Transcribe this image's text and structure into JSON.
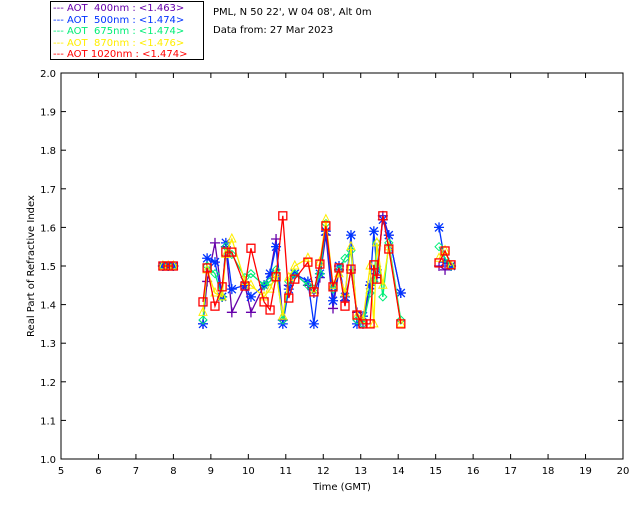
{
  "header": {
    "location": "PML, N 50 22', W 04 08', Alt 0m",
    "date": "Data from: 27 Mar 2023"
  },
  "chart_data": {
    "type": "line",
    "xlabel": "Time (GMT)",
    "ylabel": "Real Part of Refractive Index",
    "xlim": [
      5,
      20
    ],
    "ylim": [
      1.0,
      2.0
    ],
    "xticks": [
      "5",
      "6",
      "7",
      "8",
      "9",
      "10",
      "11",
      "12",
      "13",
      "14",
      "15",
      "16",
      "17",
      "18",
      "19",
      "20"
    ],
    "yticks": [
      "1.0",
      "1.1",
      "1.2",
      "1.3",
      "1.4",
      "1.5",
      "1.6",
      "1.7",
      "1.8",
      "1.9",
      "2.0"
    ],
    "grid": false,
    "legend_position": "top-left-outside",
    "x": [
      7.72,
      7.86,
      8.0,
      8.79,
      8.9,
      9.11,
      9.3,
      9.4,
      9.56,
      9.91,
      10.07,
      10.42,
      10.58,
      10.74,
      10.92,
      11.08,
      11.24,
      11.59,
      11.75,
      11.91,
      12.07,
      12.26,
      12.42,
      12.58,
      12.74,
      12.9,
      13.06,
      13.25,
      13.35,
      13.43,
      13.59,
      13.75,
      14.07,
      15.09,
      15.25,
      15.41
    ],
    "series": [
      {
        "name": "AOT  400nm : <1.463>",
        "color": "#6600aa",
        "marker": "plus",
        "values": [
          1.5,
          1.5,
          1.5,
          1.35,
          1.46,
          1.56,
          1.42,
          1.55,
          1.38,
          1.45,
          1.38,
          1.45,
          1.48,
          1.57,
          1.36,
          1.45,
          1.48,
          1.45,
          1.43,
          1.47,
          1.58,
          1.39,
          1.49,
          1.41,
          1.49,
          1.38,
          1.35,
          1.45,
          1.48,
          1.47,
          1.63,
          1.58,
          1.43,
          1.5,
          1.49,
          1.5
        ]
      },
      {
        "name": "AOT  500nm : <1.474>",
        "color": "#0033ff",
        "marker": "star",
        "values": [
          1.5,
          1.5,
          1.5,
          1.35,
          1.52,
          1.51,
          1.42,
          1.56,
          1.44,
          1.45,
          1.42,
          1.45,
          1.48,
          1.55,
          1.35,
          1.44,
          1.48,
          1.46,
          1.35,
          1.48,
          1.59,
          1.41,
          1.5,
          1.42,
          1.58,
          1.35,
          1.37,
          1.45,
          1.59,
          1.49,
          1.62,
          1.58,
          1.43,
          1.6,
          1.51,
          1.5
        ]
      },
      {
        "name": "AOT  675nm : <1.474>",
        "color": "#00ee77",
        "marker": "diamond",
        "values": [
          1.5,
          1.5,
          1.5,
          1.36,
          1.5,
          1.48,
          1.42,
          1.55,
          1.53,
          1.47,
          1.48,
          1.45,
          1.46,
          1.49,
          1.36,
          1.46,
          1.48,
          1.45,
          1.44,
          1.48,
          1.61,
          1.44,
          1.49,
          1.52,
          1.54,
          1.36,
          1.35,
          1.43,
          1.46,
          1.56,
          1.42,
          1.56,
          1.36,
          1.55,
          1.52,
          1.5
        ]
      },
      {
        "name": "AOT  870nm : <1.476>",
        "color": "#ffee00",
        "marker": "triangle",
        "values": [
          1.5,
          1.5,
          1.5,
          1.38,
          1.49,
          1.43,
          1.42,
          1.53,
          1.57,
          1.46,
          1.45,
          1.42,
          1.44,
          1.48,
          1.37,
          1.47,
          1.5,
          1.52,
          1.43,
          1.51,
          1.62,
          1.45,
          1.48,
          1.43,
          1.55,
          1.37,
          1.36,
          1.5,
          1.35,
          1.56,
          1.45,
          1.55,
          1.35,
          1.52,
          1.54,
          1.5
        ]
      },
      {
        "name": "AOT 1020nm : <1.474>",
        "color": "#ff0000",
        "marker": "square",
        "values": [
          1.5,
          1.5,
          1.5,
          1.407,
          1.495,
          1.396,
          1.446,
          1.536,
          1.536,
          1.448,
          1.546,
          1.407,
          1.386,
          1.472,
          1.63,
          1.417,
          1.466,
          1.51,
          1.433,
          1.505,
          1.604,
          1.446,
          1.495,
          1.396,
          1.492,
          1.373,
          1.35,
          1.35,
          1.503,
          1.466,
          1.63,
          1.544,
          1.35,
          1.508,
          1.539,
          1.503
        ]
      }
    ]
  }
}
